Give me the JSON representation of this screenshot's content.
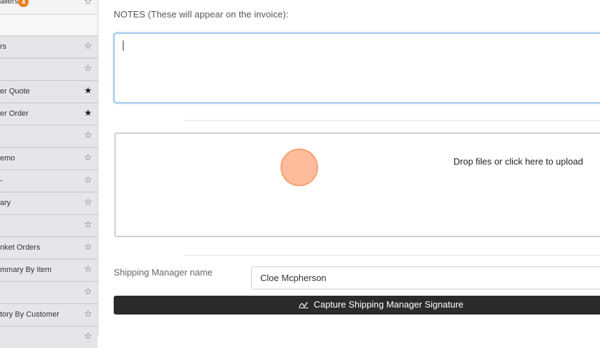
{
  "sidebar": {
    "top_item": {
      "label": "ailers",
      "badge": "4"
    },
    "items": [
      {
        "label": "rs",
        "starred": false
      },
      {
        "label": "",
        "starred": false
      },
      {
        "label": "er Quote",
        "starred": true
      },
      {
        "label": "er Order",
        "starred": true
      },
      {
        "label": "",
        "starred": false
      },
      {
        "label": "emo",
        "starred": false
      },
      {
        "label": "-",
        "starred": false
      },
      {
        "label": "ary",
        "starred": false
      },
      {
        "label": "",
        "starred": false
      },
      {
        "label": "nket Orders",
        "starred": false
      },
      {
        "label": "mmary By Item",
        "starred": false
      },
      {
        "label": "",
        "starred": false
      },
      {
        "label": "tory By Customer",
        "starred": false
      },
      {
        "label": "",
        "starred": false
      }
    ],
    "star_empty": "☆",
    "star_filled": "★"
  },
  "notes": {
    "label": "NOTES (These will appear on the invoice):",
    "value": ""
  },
  "upload": {
    "text": "Drop files or click here to upload"
  },
  "shipping_manager": {
    "label": "Shipping Manager name",
    "value": "Cloe Mcpherson"
  },
  "signature_button": {
    "icon": "signature-pen-icon",
    "label": "Capture Shipping Manager Signature"
  },
  "colors": {
    "badge": "#e8821e",
    "focus_border": "#6aa6df",
    "button_bg": "#2b2b2b",
    "cursor_highlight": "#f5a26f"
  }
}
